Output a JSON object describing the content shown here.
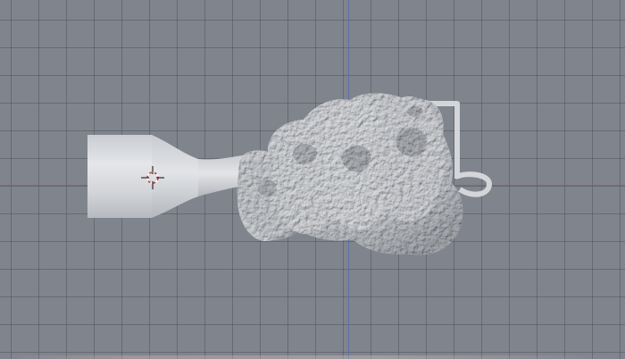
{
  "viewport": {
    "background_color": "#80848d",
    "grid_color": "#3c3f46",
    "x_axis_color": "#a65a5e",
    "y_axis_color": "#5a6fa8"
  },
  "model": {
    "material_color": "#d6d8dc",
    "shadow_color": "#a9acb2"
  },
  "cursor": {
    "icon": "3d-cursor-icon"
  }
}
